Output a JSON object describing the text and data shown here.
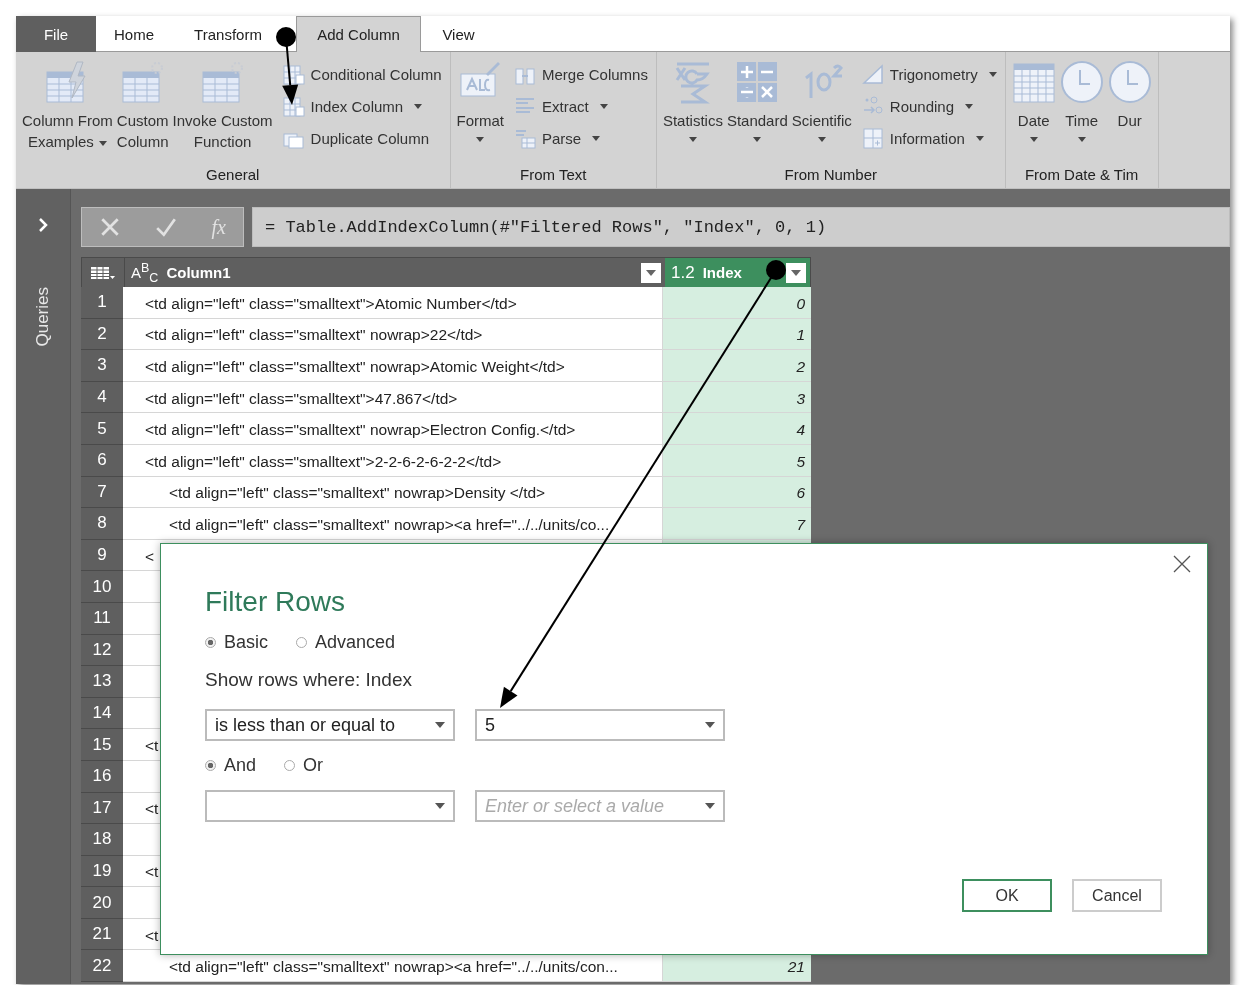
{
  "tabs": [
    {
      "label": "File",
      "kind": "file",
      "selected": false
    },
    {
      "label": "Home",
      "kind": "tab",
      "selected": false
    },
    {
      "label": "Transform",
      "kind": "tab",
      "selected": false
    },
    {
      "label": "Add Column",
      "kind": "tab",
      "selected": true
    },
    {
      "label": "View",
      "kind": "tab",
      "selected": false
    }
  ],
  "ribbon": {
    "groups": [
      {
        "title": "General",
        "large": [
          {
            "label": "Column From\nExamples",
            "dropdown": true
          },
          {
            "label": "Custom\nColumn"
          },
          {
            "label": "Invoke Custom\nFunction"
          }
        ],
        "small": [
          {
            "label": "Conditional Column"
          },
          {
            "label": "Index Column",
            "dropdown": true
          },
          {
            "label": "Duplicate Column"
          }
        ]
      },
      {
        "title": "From Text",
        "large": [
          {
            "label": "Format",
            "dropdown": true
          }
        ],
        "small": [
          {
            "label": "Merge Columns"
          },
          {
            "label": "Extract",
            "dropdown": true
          },
          {
            "label": "Parse",
            "dropdown": true
          }
        ]
      },
      {
        "title": "From Number",
        "large": [
          {
            "label": "Statistics",
            "dropdown": true
          },
          {
            "label": "Standard",
            "dropdown": true
          },
          {
            "label": "Scientific",
            "dropdown": true
          }
        ],
        "small": [
          {
            "label": "Trigonometry",
            "dropdown": true
          },
          {
            "label": "Rounding",
            "dropdown": true
          },
          {
            "label": "Information",
            "dropdown": true
          }
        ]
      },
      {
        "title": "From Date & Tim",
        "large": [
          {
            "label": "Date",
            "dropdown": true
          },
          {
            "label": "Time",
            "dropdown": true
          },
          {
            "label": "Dur"
          }
        ]
      }
    ]
  },
  "queries_pane": {
    "label": "Queries"
  },
  "formula_bar": {
    "function_label": "fx",
    "formula": "= Table.AddIndexColumn(#\"Filtered Rows\", \"Index\", 0, 1)"
  },
  "table": {
    "columns": [
      {
        "type_label": "A$^{B}$$_{C}$",
        "name": "Column1",
        "selected": false
      },
      {
        "type_label": "1.2",
        "name": "Index",
        "selected": true
      }
    ],
    "rows": [
      {
        "number": "1",
        "text": "<td align=\"left\" class=\"smalltext\">Atomic Number</td>",
        "index": "0",
        "indented": false
      },
      {
        "number": "2",
        "text": "<td align=\"left\" class=\"smalltext\" nowrap>22</td>",
        "index": "1",
        "indented": false
      },
      {
        "number": "3",
        "text": "<td align=\"left\" class=\"smalltext\" nowrap>Atomic Weight</td>",
        "index": "2",
        "indented": false
      },
      {
        "number": "4",
        "text": "<td align=\"left\" class=\"smalltext\">47.867</td>",
        "index": "3",
        "indented": false
      },
      {
        "number": "5",
        "text": "<td align=\"left\" class=\"smalltext\" nowrap>Electron Config.</td>",
        "index": "4",
        "indented": false
      },
      {
        "number": "6",
        "text": "<td align=\"left\" class=\"smalltext\">2-2-6-2-6-2-2</td>",
        "index": "5",
        "indented": false
      },
      {
        "number": "7",
        "text": "<td align=\"left\" class=\"smalltext\" nowrap>Density </td>",
        "index": "6",
        "indented": true
      },
      {
        "number": "8",
        "text": "<td align=\"left\" class=\"smalltext\" nowrap><a href=\"../../units/co...",
        "index": "7",
        "indented": true
      },
      {
        "number": "9",
        "text": "<",
        "indented": false
      },
      {
        "number": "10"
      },
      {
        "number": "11"
      },
      {
        "number": "12"
      },
      {
        "number": "13"
      },
      {
        "number": "14"
      },
      {
        "number": "15",
        "text": "<t",
        "indented": false
      },
      {
        "number": "16"
      },
      {
        "number": "17",
        "text": "<t",
        "indented": false
      },
      {
        "number": "18"
      },
      {
        "number": "19",
        "text": "<t",
        "indented": false
      },
      {
        "number": "20"
      },
      {
        "number": "21",
        "text": "<t",
        "indented": false
      },
      {
        "number": "22",
        "text": "<td align=\"left\" class=\"smalltext\" nowrap><a href=\"../../units/con...",
        "index": "21",
        "indented": true
      }
    ]
  },
  "dialog": {
    "title": "Filter Rows",
    "modes": [
      {
        "label": "Basic",
        "selected": true
      },
      {
        "label": "Advanced",
        "selected": false
      }
    ],
    "prompt": "Show rows where: Index",
    "conditions": [
      {
        "operator": "is less than or equal to",
        "value": "5"
      },
      {
        "placeholder": "Enter or select a value"
      }
    ],
    "joins": [
      {
        "label": "And",
        "selected": true
      },
      {
        "label": "Or",
        "selected": false
      }
    ],
    "buttons": [
      {
        "label": "OK",
        "kind": "primary"
      },
      {
        "label": "Cancel",
        "kind": "secondary"
      }
    ]
  }
}
